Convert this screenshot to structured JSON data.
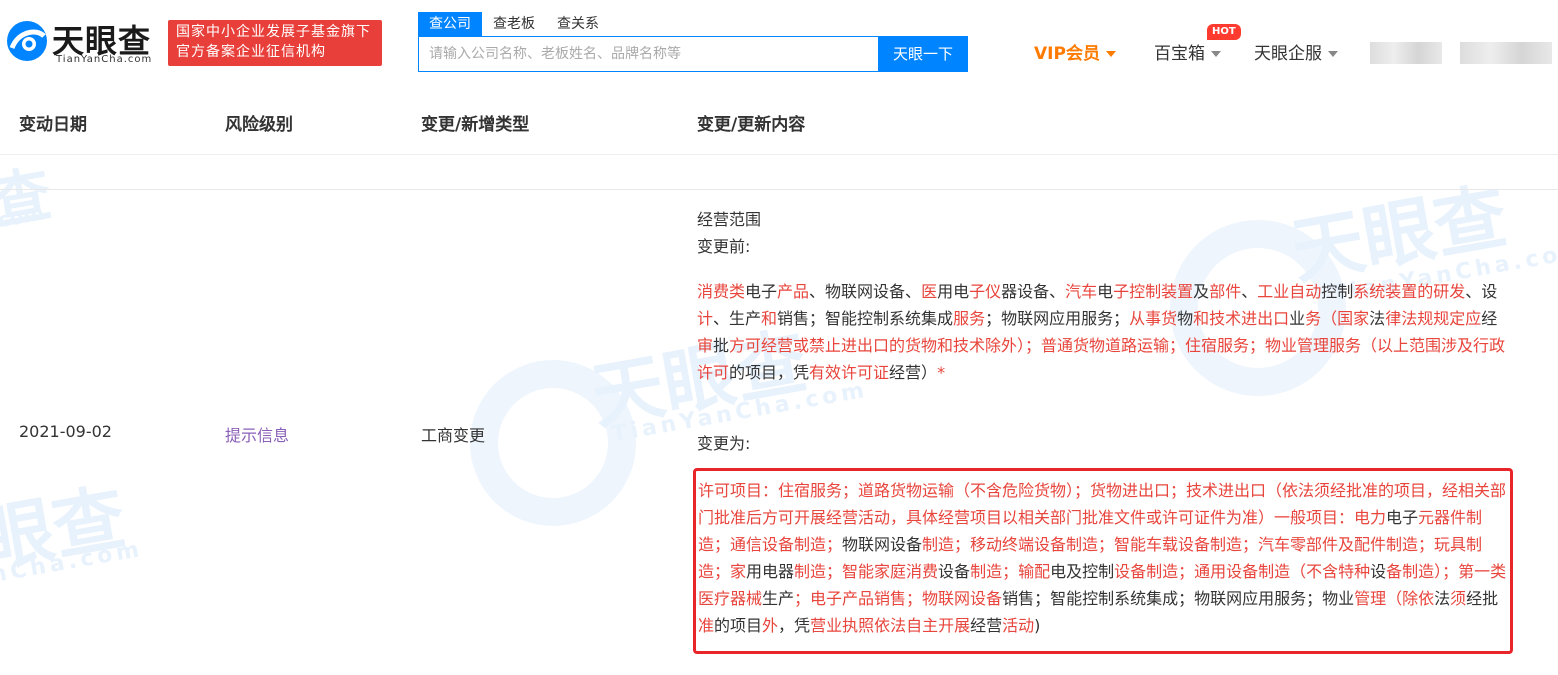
{
  "header": {
    "logo_cn": "天眼查",
    "logo_en": "TianYanCha.com",
    "badge_line1": "国家中小企业发展子基金旗下",
    "badge_line2": "官方备案企业征信机构",
    "search_tabs": [
      "查公司",
      "查老板",
      "查关系"
    ],
    "search_placeholder": "请输入公司名称、老板姓名、品牌名称等",
    "search_button": "天眼一下",
    "nav_vip": "VIP会员",
    "nav_baibaoxiang": "百宝箱",
    "nav_hot": "HOT",
    "nav_qifu": "天眼企服"
  },
  "table": {
    "headers": [
      "变动日期",
      "风险级别",
      "变更/新增类型",
      "变更/更新内容"
    ],
    "row": {
      "date": "2021-09-02",
      "risk_level": "提示信息",
      "change_type": "工商变更",
      "field_name": "经营范围",
      "before_label": "变更前:",
      "after_label": "变更为:"
    }
  },
  "colors": {
    "accent": "#0084ff",
    "brand_red": "#e83f3a",
    "vip": "#ff7b00",
    "diff_red": "#e8453c",
    "risk_purple": "#8a5fb8"
  }
}
